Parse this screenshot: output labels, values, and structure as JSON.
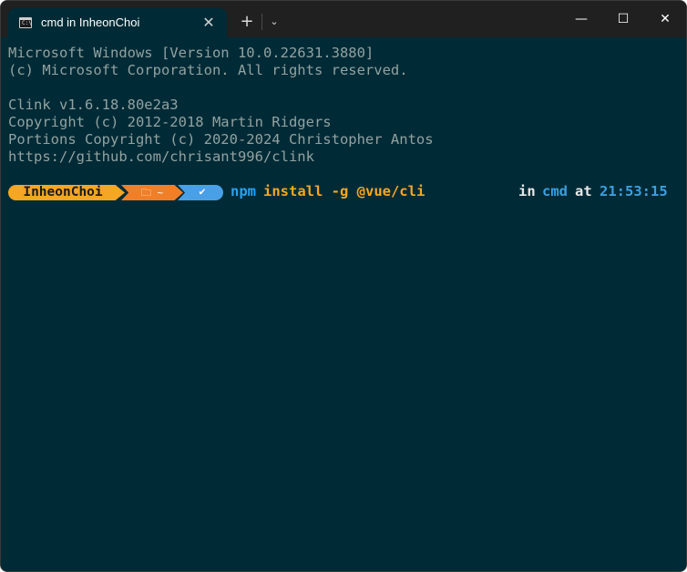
{
  "window": {
    "tab_title": "cmd in InheonChoi",
    "tab_close": "✕",
    "new_tab": "+",
    "dropdown": "⌄",
    "minimize": "—",
    "maximize": "☐",
    "close": "✕"
  },
  "terminal": {
    "lines": [
      "Microsoft Windows [Version 10.0.22631.3880]",
      "(c) Microsoft Corporation. All rights reserved.",
      "",
      "Clink v1.6.18.80e2a3",
      "Copyright (c) 2012-2018 Martin Ridgers",
      "Portions Copyright (c) 2020-2024 Christopher Antos",
      "https://github.com/chrisant996/clink"
    ],
    "prompt": {
      "user": "InheonChoi",
      "dir": "🗀 ~",
      "status": "✔",
      "command_word": "npm",
      "command_args": "install -g @vue/cli",
      "in_label": "in",
      "shell": "cmd",
      "at_label": "at",
      "time": "21:53:15"
    }
  },
  "colors": {
    "background": "#002b36",
    "titlebar": "#202020",
    "user_segment": "#f5a623",
    "dir_segment": "#f07f27",
    "status_segment": "#4aa0e6",
    "command": "#2aa1f0",
    "args": "#f5a623"
  }
}
